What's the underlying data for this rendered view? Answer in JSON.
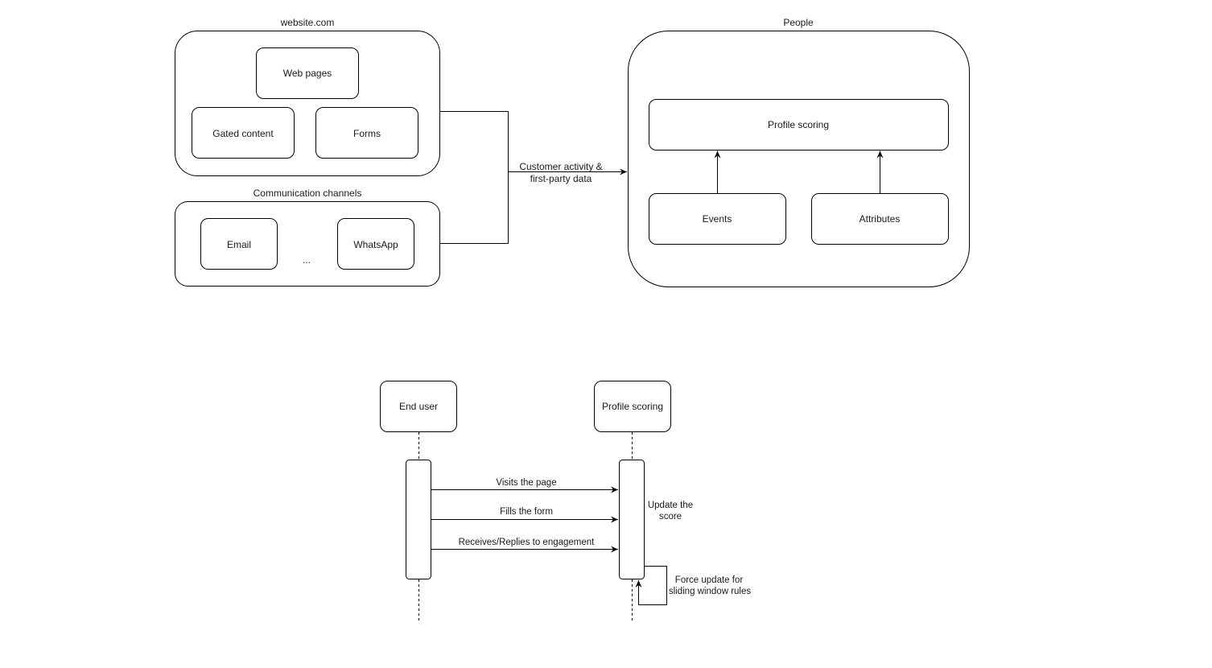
{
  "top_diagram": {
    "website_group": {
      "title": "website.com",
      "items": [
        "Web pages",
        "Gated content",
        "Forms"
      ]
    },
    "channels_group": {
      "title": "Communication channels",
      "items": [
        "Email",
        "WhatsApp"
      ],
      "ellipsis": "..."
    },
    "connector_label": [
      "Customer activity &",
      "first-party data"
    ],
    "people_group": {
      "title": "People",
      "scoring": "Profile scoring",
      "inputs": [
        "Events",
        "Attributes"
      ]
    }
  },
  "sequence_diagram": {
    "participants": [
      "End user",
      "Profile scoring"
    ],
    "messages": [
      "Visits the page",
      "Fills the form",
      "Receives/Replies to engagement"
    ],
    "note": [
      "Update the",
      "score"
    ],
    "self_call": [
      "Force update for",
      "sliding window rules"
    ]
  }
}
